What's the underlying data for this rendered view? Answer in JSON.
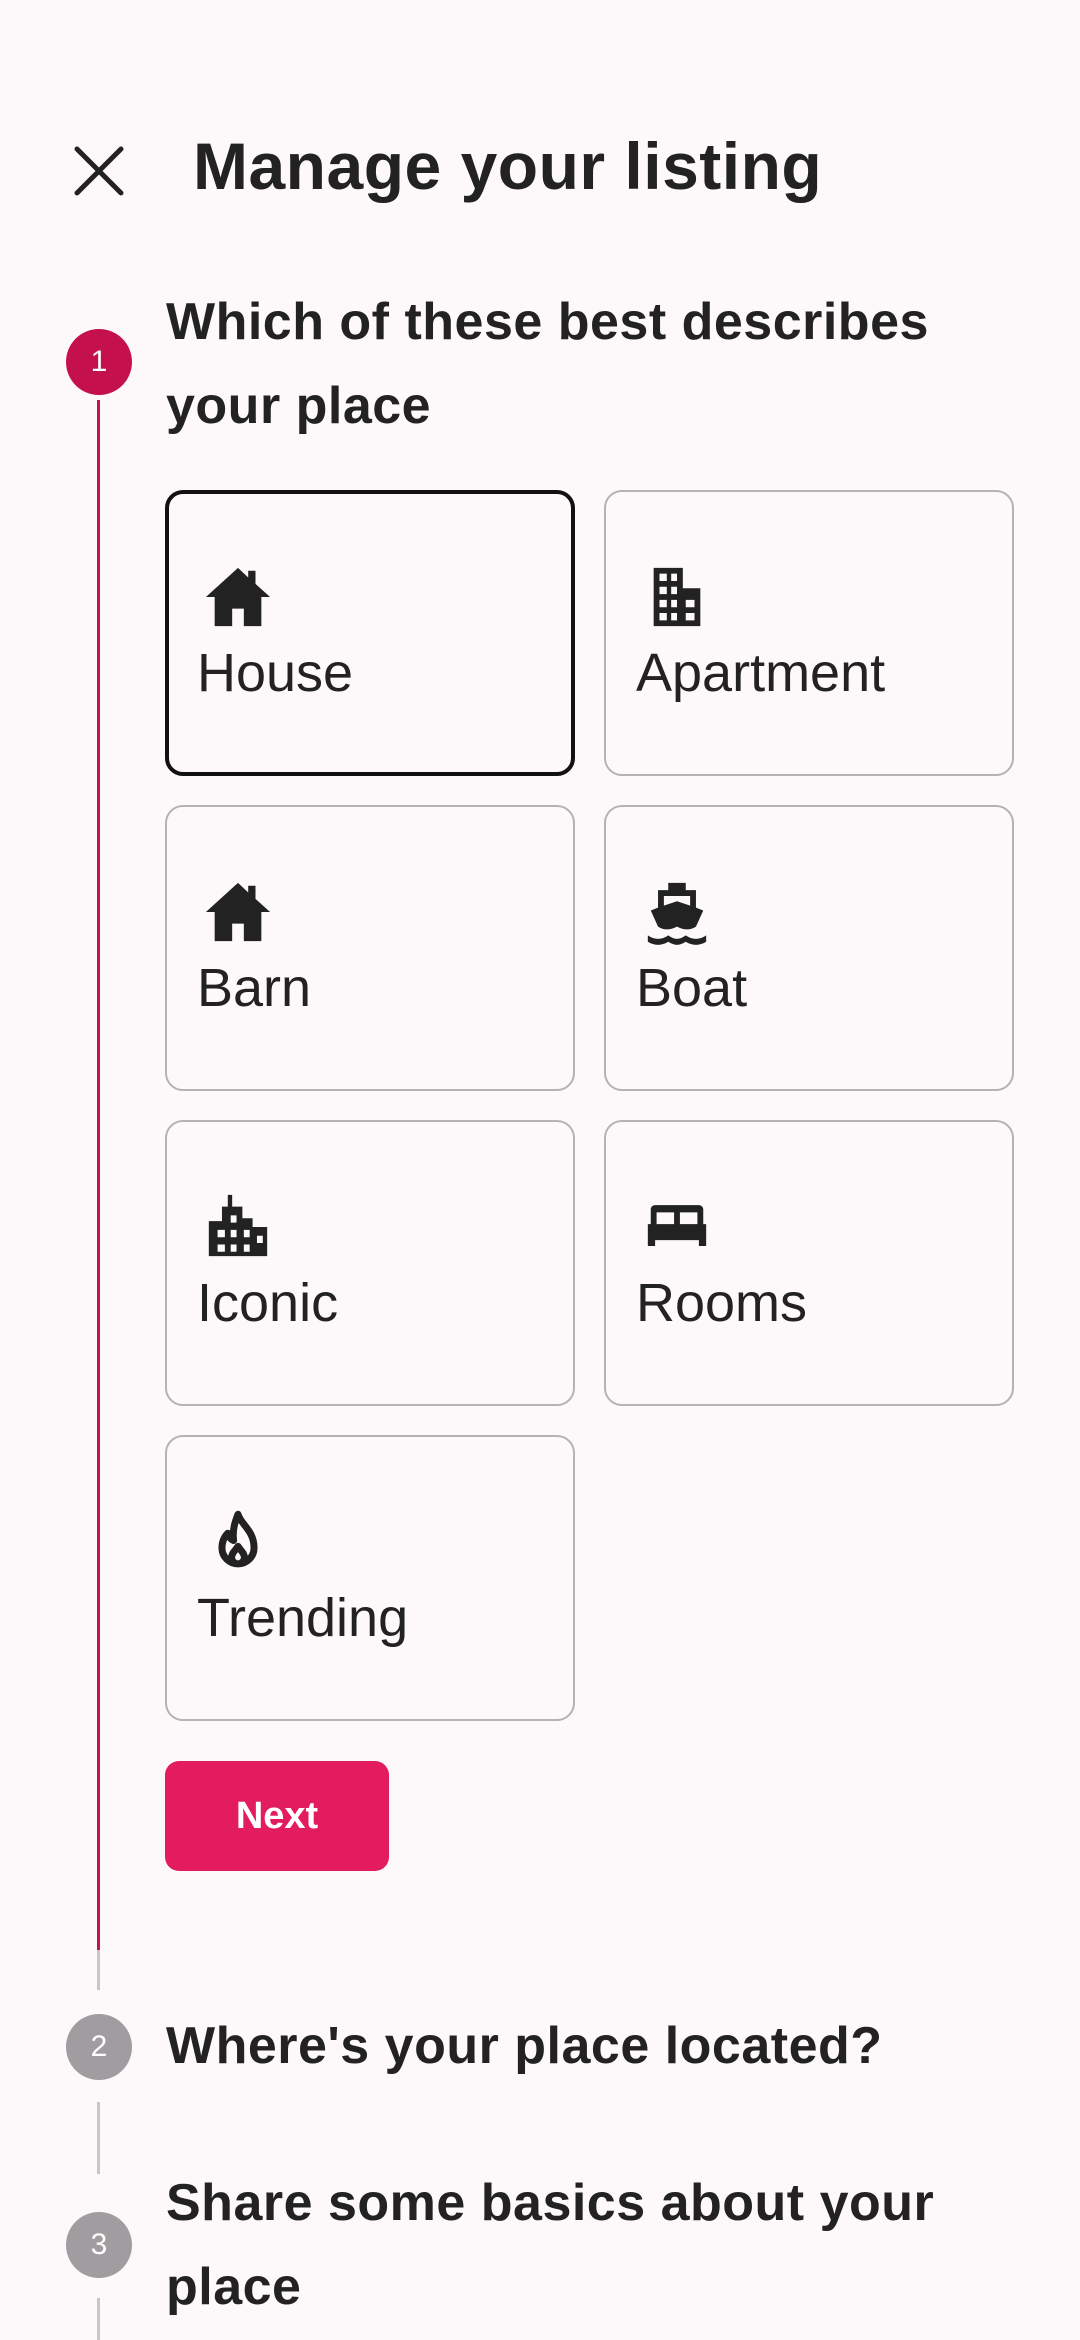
{
  "status_bar": {
    "time": "",
    "right": ""
  },
  "header": {
    "title": "Manage your listing"
  },
  "steps": [
    {
      "number": "1",
      "title_line1": "Which of these best describes",
      "title_line2": "your place"
    },
    {
      "number": "2",
      "title_line1": "Where's your place located?"
    },
    {
      "number": "3",
      "title_line1": "Share some basics about your",
      "title_line2": "place"
    }
  ],
  "property_types": [
    {
      "label": "House",
      "icon": "house-icon",
      "selected": true
    },
    {
      "label": "Apartment",
      "icon": "apartment-building-icon",
      "selected": false
    },
    {
      "label": "Barn",
      "icon": "barn-icon",
      "selected": false
    },
    {
      "label": "Boat",
      "icon": "boat-icon",
      "selected": false
    },
    {
      "label": "Iconic",
      "icon": "iconic-city-icon",
      "selected": false
    },
    {
      "label": "Rooms",
      "icon": "bed-icon",
      "selected": false
    },
    {
      "label": "Trending",
      "icon": "flame-icon",
      "selected": false
    }
  ],
  "actions": {
    "next_label": "Next"
  },
  "colors": {
    "accent": "#e31c5f",
    "step_active": "#c4104c",
    "step_inactive": "#a09c9f",
    "background": "#fdf9fb"
  }
}
